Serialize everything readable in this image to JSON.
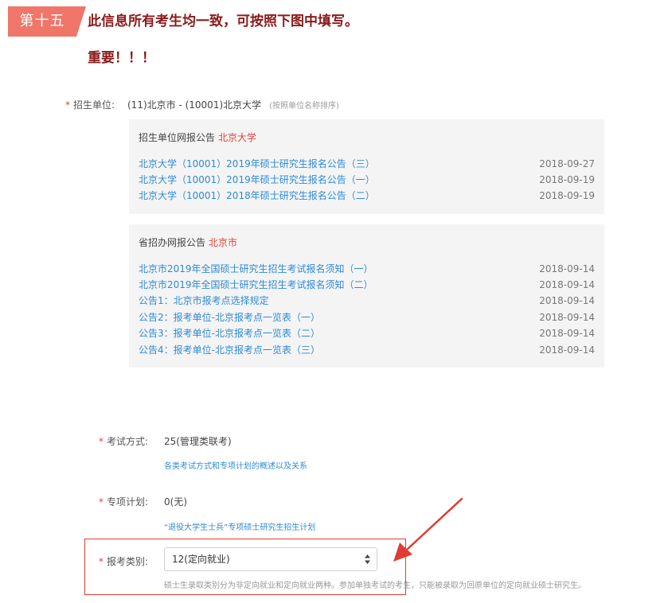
{
  "step": {
    "label": "第十五"
  },
  "headline": "此信息所有考生均一致，可按照下图中填写。",
  "important": "重要！！！",
  "recruit_unit": {
    "label": "招生单位:",
    "value": "(11)北京市 - (10001)北京大学",
    "hint": "(按照单位名称排序)"
  },
  "unit_notices": {
    "title": "招生单位网报公告",
    "title_highlight": "北京大学",
    "items": [
      {
        "text": "北京大学（10001）2019年硕士研究生报名公告（三）",
        "date": "2018-09-27"
      },
      {
        "text": "北京大学（10001）2019年硕士研究生报名公告（一）",
        "date": "2018-09-19"
      },
      {
        "text": "北京大学（10001）2018年硕士研究生报名公告（二）",
        "date": "2018-09-19"
      }
    ]
  },
  "province_notices": {
    "title": "省招办网报公告",
    "title_highlight": "北京市",
    "items": [
      {
        "text": "北京市2019年全国硕士研究生招生考试报名须知（一）",
        "date": "2018-09-14"
      },
      {
        "text": "北京市2019年全国硕士研究生招生考试报名须知（二）",
        "date": "2018-09-14"
      },
      {
        "text": "公告1：北京市报考点选择规定",
        "date": "2018-09-14"
      },
      {
        "text": "公告2：报考单位-北京报考点一览表（一）",
        "date": "2018-09-14"
      },
      {
        "text": "公告3：报考单位-北京报考点一览表（二）",
        "date": "2018-09-14"
      },
      {
        "text": "公告4：报考单位-北京报考点一览表（三）",
        "date": "2018-09-14"
      }
    ]
  },
  "exam_method": {
    "label": "考试方式:",
    "value": "25(管理类联考)",
    "link": "各类考试方式和专项计划的概述以及关系"
  },
  "special_plan": {
    "label": "专项计划:",
    "value": "0(无)",
    "link": "“退役大学生士兵”专项硕士研究生招生计划"
  },
  "apply_category": {
    "label": "报考类别:",
    "selected": "12(定向就业)",
    "explain": "硕士生录取类别分为非定向就业和定向就业两种。参加单独考试的考生，只能被录取为回原单位的定向就业硕士研究生。"
  },
  "required_mark": "*",
  "colors": {
    "step_tag": "#f0766a",
    "headline": "#8b1a1a",
    "link": "#2e8bd7",
    "required": "#e0443a",
    "highlight_box": "#e03c31"
  }
}
